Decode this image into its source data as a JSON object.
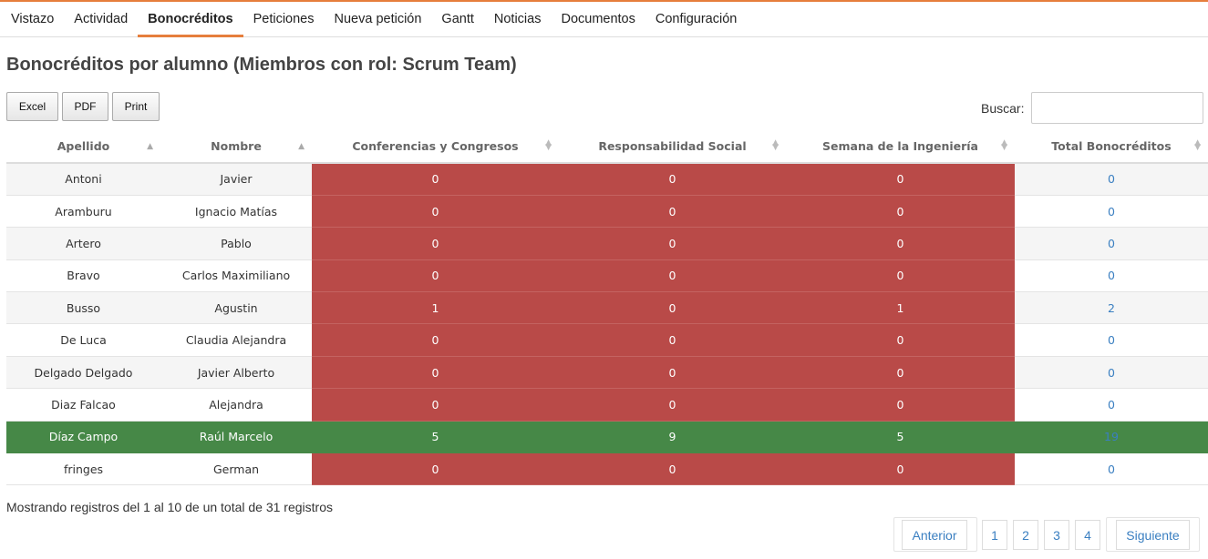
{
  "nav": {
    "items": [
      {
        "label": "Vistazo"
      },
      {
        "label": "Actividad"
      },
      {
        "label": "Bonocréditos"
      },
      {
        "label": "Peticiones"
      },
      {
        "label": "Nueva petición"
      },
      {
        "label": "Gantt"
      },
      {
        "label": "Noticias"
      },
      {
        "label": "Documentos"
      },
      {
        "label": "Configuración"
      }
    ],
    "active": "Bonocréditos"
  },
  "page": {
    "title": "Bonocréditos por alumno (Miembros con rol: Scrum Team)"
  },
  "toolbar": {
    "excel_label": "Excel",
    "pdf_label": "PDF",
    "print_label": "Print",
    "search_label": "Buscar:",
    "search_value": ""
  },
  "table": {
    "columns": [
      "Apellido",
      "Nombre",
      "Conferencias y Congresos",
      "Responsabilidad Social",
      "Semana de la Ingeniería",
      "Total Bonocréditos"
    ],
    "rows": [
      [
        "Antoni",
        "Javier",
        "0",
        "0",
        "0",
        "0"
      ],
      [
        "Aramburu",
        "Ignacio Matías",
        "0",
        "0",
        "0",
        "0"
      ],
      [
        "Artero",
        "Pablo",
        "0",
        "0",
        "0",
        "0"
      ],
      [
        "Bravo",
        "Carlos Maximiliano",
        "0",
        "0",
        "0",
        "0"
      ],
      [
        "Busso",
        "Agustin",
        "1",
        "0",
        "1",
        "2"
      ],
      [
        "De Luca",
        "Claudia Alejandra",
        "0",
        "0",
        "0",
        "0"
      ],
      [
        "Delgado Delgado",
        "Javier Alberto",
        "0",
        "0",
        "0",
        "0"
      ],
      [
        "Diaz Falcao",
        "Alejandra",
        "0",
        "0",
        "0",
        "0"
      ],
      [
        "Díaz Campo",
        "Raúl Marcelo",
        "5",
        "9",
        "5",
        "19"
      ],
      [
        "fringes",
        "German",
        "0",
        "0",
        "0",
        "0"
      ]
    ],
    "highlight_row": 8,
    "colors": {
      "red": "#b94a48",
      "green": "#468847",
      "link": "#3a7fc1"
    }
  },
  "footer": {
    "info": "Mostrando registros del 1 al 10 de un total de 31 registros",
    "prev_label": "Anterior",
    "pages": [
      "1",
      "2",
      "3",
      "4"
    ],
    "next_label": "Siguiente"
  }
}
